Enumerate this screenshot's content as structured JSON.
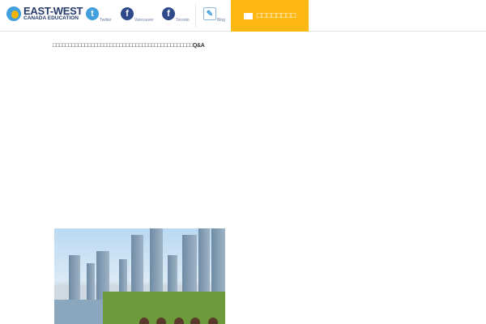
{
  "header": {
    "logo": {
      "line1": "EAST-WEST",
      "line2": "CANADA EDUCATION"
    },
    "social": [
      {
        "icon": "twitter-icon",
        "label": "Twitter"
      },
      {
        "icon": "facebook-icon",
        "label": "Vancouver"
      },
      {
        "icon": "facebook-icon",
        "label": "Toronto"
      },
      {
        "icon": "blog-icon",
        "label": "Blog"
      }
    ],
    "contact_label": "□□□□□□□□"
  },
  "main": {
    "intro_text": "□□□□□□□□□□□□□□□□□□□□□□□□□□□□□□□□□□□□□□□□□□□□Q&A"
  },
  "colors": {
    "accent": "#fdb813",
    "brand": "#233a6b",
    "twitter": "#3fa0dd",
    "facebook": "#2f4a8a"
  }
}
